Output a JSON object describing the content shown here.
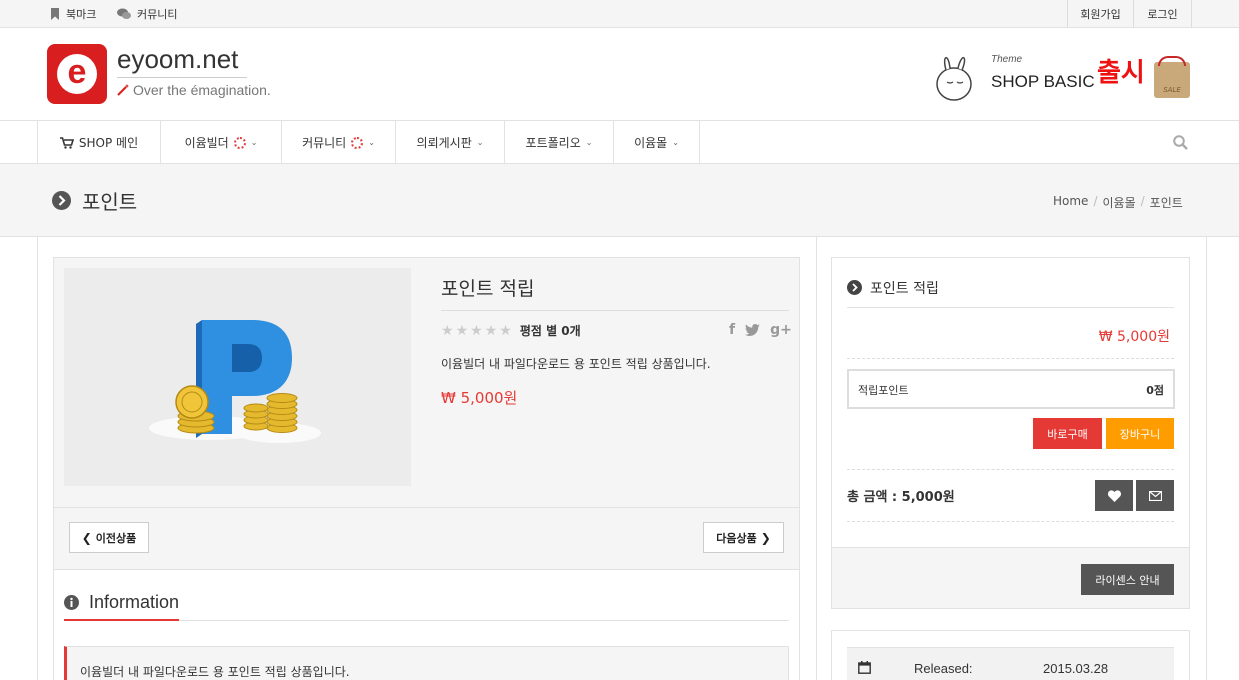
{
  "topbar": {
    "bookmark": "북마크",
    "community": "커뮤니티",
    "signup": "회원가입",
    "login": "로그인"
  },
  "logo": {
    "letter": "e",
    "name": "eyoom.net",
    "tagline": "Over the émagination."
  },
  "banner": {
    "theme_label": "Theme",
    "shop_basic": "SHOP BASIC",
    "release": "출시",
    "sale_tag": "SALE"
  },
  "nav": {
    "items": [
      {
        "label": "SHOP 메인"
      },
      {
        "label": "이윰빌더"
      },
      {
        "label": "커뮤니티"
      },
      {
        "label": "의뢰게시판"
      },
      {
        "label": "포트폴리오"
      },
      {
        "label": "이윰몰"
      }
    ]
  },
  "page": {
    "title": "포인트",
    "breadcrumb": [
      "Home",
      "이윰몰",
      "포인트"
    ]
  },
  "product": {
    "name": "포인트 적립",
    "rating_text": "평점 별 0개",
    "rating": 0,
    "rating_max": 5,
    "description": "이윰빌더 내 파일다운로드 용 포인트 적립 상품입니다.",
    "price": "₩ 5,000원",
    "prev": "이전상품",
    "next": "다음상품"
  },
  "info": {
    "heading": "Information",
    "text": "이윰빌더 내 파일다운로드 용 포인트 적립 상품입니다."
  },
  "sidebar": {
    "title": "포인트 적립",
    "price": "₩ 5,000원",
    "points_label": "적립포인트",
    "points_value": "0점",
    "buy_now": "바로구매",
    "cart": "장바구니",
    "total": "총 금액 : 5,000원",
    "license": "라이센스 안내"
  },
  "details": {
    "released_label": "Released:",
    "released_value": "2015.03.28"
  },
  "colors": {
    "brand_red": "#e23b3b",
    "buy_red": "#e53935",
    "cart_orange": "#ff9c00",
    "dark_button": "#555555"
  }
}
